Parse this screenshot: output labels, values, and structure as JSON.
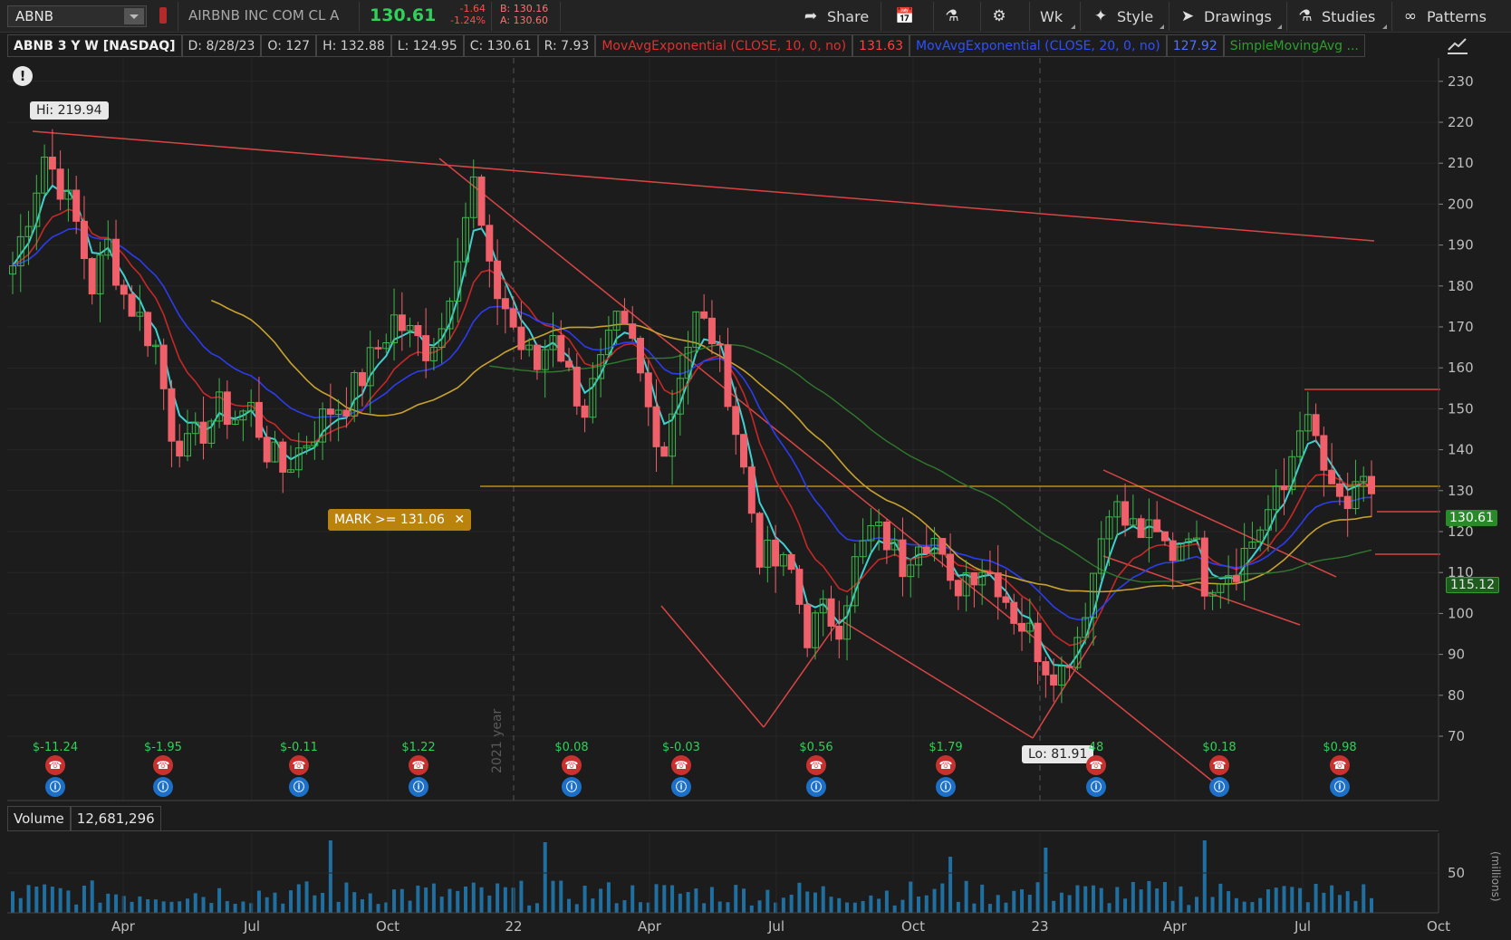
{
  "toolbar": {
    "symbol": "ABNB",
    "company": "AIRBNB INC COM CL A",
    "last": "130.61",
    "change": "-1.64",
    "change_pct": "-1.24%",
    "bid": "B: 130.16",
    "ask": "A: 130.60",
    "buttons": [
      "Share",
      "Wk",
      "Style",
      "Drawings",
      "Studies",
      "Patterns"
    ],
    "icons": [
      "share-icon",
      "calendar-icon",
      "flask-icon",
      "gear-icon",
      "style-icon",
      "cursor-icon",
      "studies-flask-icon",
      "patterns-icon"
    ]
  },
  "header": {
    "title": "ABNB 3 Y W [NASDAQ]",
    "date": "D: 8/28/23",
    "open": "O: 127",
    "high": "H: 132.88",
    "low": "L: 124.95",
    "close": "C: 130.61",
    "range": "R: 7.93",
    "studies": [
      {
        "label": "MovAvgExponential (CLOSE, 10, 0, no)",
        "value": "131.63",
        "color": "#e03030"
      },
      {
        "label": "MovAvgExponential (CLOSE, 20, 0, no)",
        "value": "127.92",
        "color": "#3050ff"
      },
      {
        "label": "SimpleMovingAvg ...",
        "value": "",
        "color": "#2f9e2f"
      }
    ]
  },
  "chart_data": {
    "type": "candlestick",
    "symbol": "ABNB",
    "interval": "weekly",
    "period": "3 Y",
    "y_ticks": [
      70,
      80,
      90,
      100,
      110,
      120,
      130,
      140,
      150,
      160,
      170,
      180,
      190,
      200,
      210,
      220,
      230
    ],
    "ylim": [
      66,
      236
    ],
    "x_labels": [
      "Apr",
      "Jul",
      "Oct",
      "22",
      "Apr",
      "Jul",
      "Oct",
      "23",
      "Apr",
      "Jul",
      "Oct"
    ],
    "year_marker": "2021 year",
    "high_label": "Hi: 219.94",
    "low_label": "Lo: 81.91",
    "mark_label": "MARK >= 131.06",
    "mark_value": 131.06,
    "last_price_tag": "130.61",
    "ma_tag": "115.12",
    "close_path": [
      [
        0,
        185
      ],
      [
        2,
        198
      ],
      [
        4,
        212
      ],
      [
        6,
        205
      ],
      [
        8,
        195
      ],
      [
        10,
        180
      ],
      [
        12,
        190
      ],
      [
        14,
        178
      ],
      [
        16,
        172
      ],
      [
        18,
        165
      ],
      [
        20,
        145
      ],
      [
        22,
        140
      ],
      [
        24,
        145
      ],
      [
        26,
        150
      ],
      [
        28,
        148
      ],
      [
        30,
        150
      ],
      [
        32,
        140
      ],
      [
        34,
        135
      ],
      [
        36,
        140
      ],
      [
        38,
        145
      ],
      [
        40,
        150
      ],
      [
        42,
        152
      ],
      [
        44,
        158
      ],
      [
        46,
        165
      ],
      [
        48,
        172
      ],
      [
        50,
        168
      ],
      [
        52,
        165
      ],
      [
        54,
        170
      ],
      [
        56,
        190
      ],
      [
        58,
        205
      ],
      [
        60,
        182
      ],
      [
        62,
        175
      ],
      [
        64,
        165
      ],
      [
        66,
        160
      ],
      [
        68,
        170
      ],
      [
        70,
        158
      ],
      [
        72,
        150
      ],
      [
        74,
        160
      ],
      [
        76,
        170
      ],
      [
        78,
        165
      ],
      [
        80,
        150
      ],
      [
        82,
        140
      ],
      [
        84,
        160
      ],
      [
        86,
        172
      ],
      [
        88,
        168
      ],
      [
        90,
        155
      ],
      [
        92,
        135
      ],
      [
        94,
        115
      ],
      [
        96,
        112
      ],
      [
        98,
        110
      ],
      [
        100,
        95
      ],
      [
        102,
        100
      ],
      [
        104,
        98
      ],
      [
        106,
        112
      ],
      [
        108,
        120
      ],
      [
        110,
        118
      ],
      [
        112,
        112
      ],
      [
        114,
        120
      ],
      [
        116,
        118
      ],
      [
        118,
        105
      ],
      [
        120,
        110
      ],
      [
        122,
        112
      ],
      [
        124,
        108
      ],
      [
        126,
        100
      ],
      [
        128,
        95
      ],
      [
        130,
        88
      ],
      [
        132,
        86
      ],
      [
        134,
        95
      ],
      [
        136,
        110
      ],
      [
        138,
        128
      ],
      [
        140,
        122
      ],
      [
        142,
        120
      ],
      [
        144,
        118
      ],
      [
        146,
        115
      ],
      [
        148,
        122
      ],
      [
        150,
        108
      ],
      [
        152,
        110
      ],
      [
        154,
        112
      ],
      [
        156,
        118
      ],
      [
        158,
        125
      ],
      [
        160,
        130
      ],
      [
        162,
        148
      ],
      [
        164,
        142
      ],
      [
        166,
        128
      ],
      [
        168,
        126
      ],
      [
        170,
        130
      ]
    ],
    "earnings": [
      "$-11.24",
      "$-1.95",
      "$-0.11",
      "$1.22",
      "$0.08",
      "$-0.03",
      "$0.56",
      "$1.79",
      "48",
      "$0.18",
      "$0.98"
    ],
    "volume_label": "Volume",
    "volume_value": "12,681,296",
    "volume_tick": "50",
    "volume_unit": "(millions)"
  }
}
